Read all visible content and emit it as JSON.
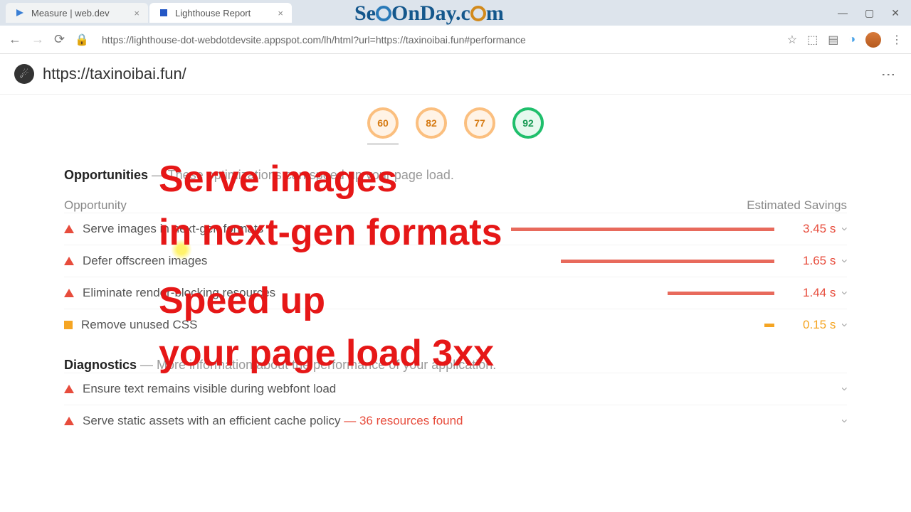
{
  "tabs": [
    {
      "title": "Measure  |  web.dev"
    },
    {
      "title": "Lighthouse Report"
    }
  ],
  "url": "https://lighthouse-dot-webdotdevsite.appspot.com/lh/html?url=https://taxinoibai.fun#performance",
  "site": "https://taxinoibai.fun/",
  "scores": [
    "60",
    "82",
    "77",
    "92"
  ],
  "opportunities": {
    "title": "Opportunities",
    "subtitle": " — These optimizations can speed up your page load.",
    "col1": "Opportunity",
    "col2": "Estimated Savings",
    "rows": [
      {
        "label": "Serve images in next-gen formats",
        "time": "3.45 s",
        "bar": 370,
        "sev": "red"
      },
      {
        "label": "Defer offscreen images",
        "time": "1.65 s",
        "bar": 300,
        "sev": "red"
      },
      {
        "label": "Eliminate render-blocking resources",
        "time": "1.44 s",
        "bar": 150,
        "sev": "red"
      },
      {
        "label": "Remove unused CSS",
        "time": "0.15 s",
        "bar": 14,
        "sev": "orange"
      }
    ]
  },
  "diagnostics": {
    "title": "Diagnostics",
    "subtitle": " — More information about the performance of your application.",
    "rows": [
      {
        "label": "Ensure text remains visible during webfont load",
        "extra": ""
      },
      {
        "label": "Serve static assets with an efficient cache policy",
        "extra": " — 36 resources found"
      }
    ]
  },
  "overlay": {
    "logo": "SeoOnDay.com",
    "l1": "Serve images",
    "l2": "in next-gen formats",
    "l3": "Speed up",
    "l4": "your page load 3xx"
  }
}
